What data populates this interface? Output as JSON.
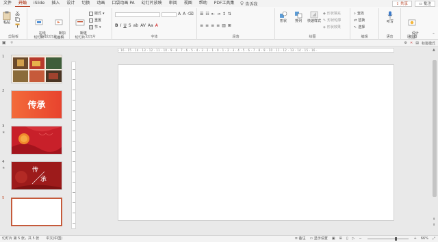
{
  "tabs": [
    "文件",
    "开始",
    "iSlide",
    "插入",
    "设计",
    "切换",
    "动画",
    "口袋动画 PA",
    "幻灯片放映",
    "审阅",
    "视图",
    "帮助",
    "PDF工具集"
  ],
  "active_tab": "开始",
  "tell_me": "告诉我",
  "share_label": "共享",
  "comment_label": "批注",
  "ribbon": {
    "clipboard": {
      "label": "剪贴板",
      "paste": "粘贴"
    },
    "islide": {
      "label": "在线幻灯片",
      "online": "在线\n幻灯片",
      "add": "新加\n动画稿"
    },
    "slides": {
      "label": "幻灯片",
      "new_slide": "新建\n幻灯片",
      "layout": "版式",
      "reset": "重置",
      "section": "节"
    },
    "font": {
      "label": "字体"
    },
    "paragraph": {
      "label": "段落"
    },
    "drawing": {
      "label": "绘图",
      "shape": "形状",
      "arrange": "排列",
      "quick_styles": "快速样式",
      "fill": "形状填充",
      "outline": "形状轮廓",
      "effect": "形状效果"
    },
    "editing": {
      "label": "编辑",
      "find": "查找",
      "replace": "替换",
      "select": "选择"
    },
    "voice": {
      "label": "语音",
      "dictate": "听写"
    },
    "designer": {
      "label": "设计器",
      "design_ideas": "设计\n灵感"
    }
  },
  "qa": {
    "view_mode": "标签模式"
  },
  "ruler_text": "· 16 · 15 · 14 · 13 · 12 · 11 · 10 · 9 · 8 · 7 · 6 · 5 · 4 · 3 · 2 · 1 · 0 · 1 · 2 · 3 · 4 · 5 · 6 · 7 · 8 · 9 · 10 · 11 · 12 · 13 · 14 · 15 · 16 ·",
  "slides": [
    {
      "num": "1",
      "star": ""
    },
    {
      "num": "2",
      "star": "",
      "title": "传承"
    },
    {
      "num": "3",
      "star": "★"
    },
    {
      "num": "4",
      "star": "★",
      "title_a": "传",
      "title_b": "承"
    },
    {
      "num": "5",
      "star": ""
    }
  ],
  "status": {
    "slide_info": "幻灯片 第 5 张，共 5 张",
    "language": "中文(中国)",
    "notes": "备注",
    "display": "显示设置",
    "zoom": "66%"
  },
  "colors": {
    "accent": "#b7472a",
    "slide2_bg": "#f0592f",
    "slide3_bg": "#c8202a",
    "slide4_bg": "#9d1b1b"
  }
}
